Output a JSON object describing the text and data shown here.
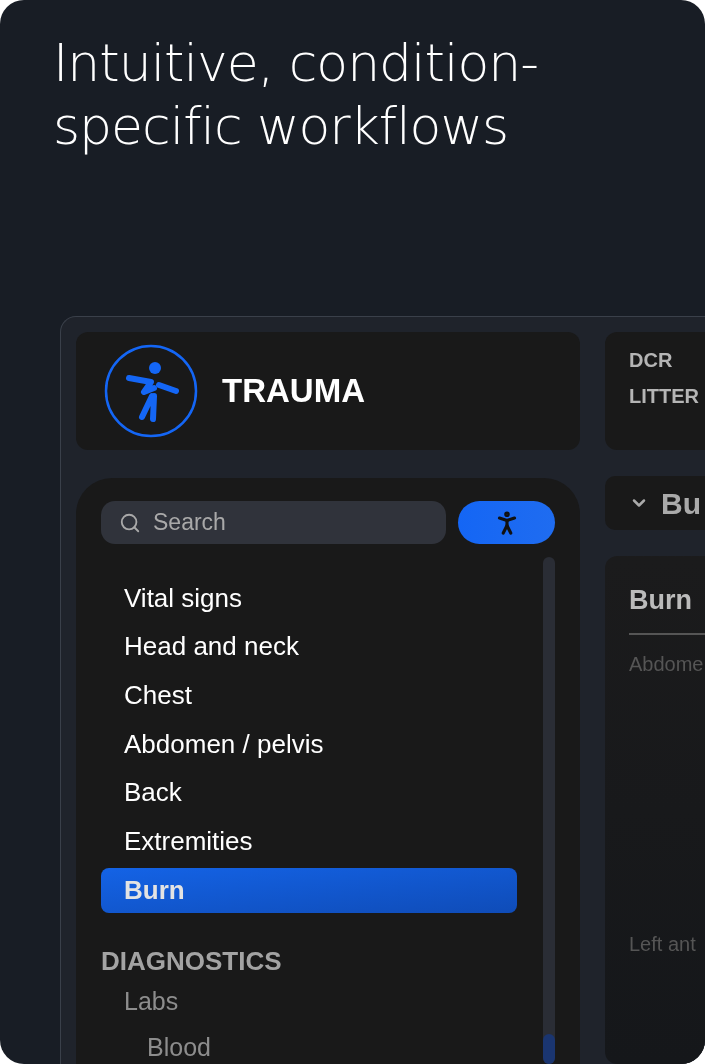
{
  "headline": "Intuitive, condition-specific workflows",
  "header": {
    "title": "TRAUMA"
  },
  "search": {
    "placeholder": "Search"
  },
  "nav": [
    {
      "label": "Vital signs",
      "selected": false
    },
    {
      "label": "Head and neck",
      "selected": false
    },
    {
      "label": "Chest",
      "selected": false
    },
    {
      "label": "Abdomen / pelvis",
      "selected": false
    },
    {
      "label": "Back",
      "selected": false
    },
    {
      "label": "Extremities",
      "selected": false
    },
    {
      "label": "Burn",
      "selected": true
    }
  ],
  "sections": [
    {
      "title": "DIAGNOSTICS",
      "items": [
        {
          "label": "Labs",
          "children": [
            {
              "label": "Blood"
            }
          ]
        }
      ]
    }
  ],
  "tags": [
    "DCR",
    "LITTER"
  ],
  "section_bar": {
    "title": "Bu",
    "expanded": true
  },
  "card": {
    "title": "Burn",
    "fields": [
      "Abdome",
      "Left ant"
    ]
  }
}
